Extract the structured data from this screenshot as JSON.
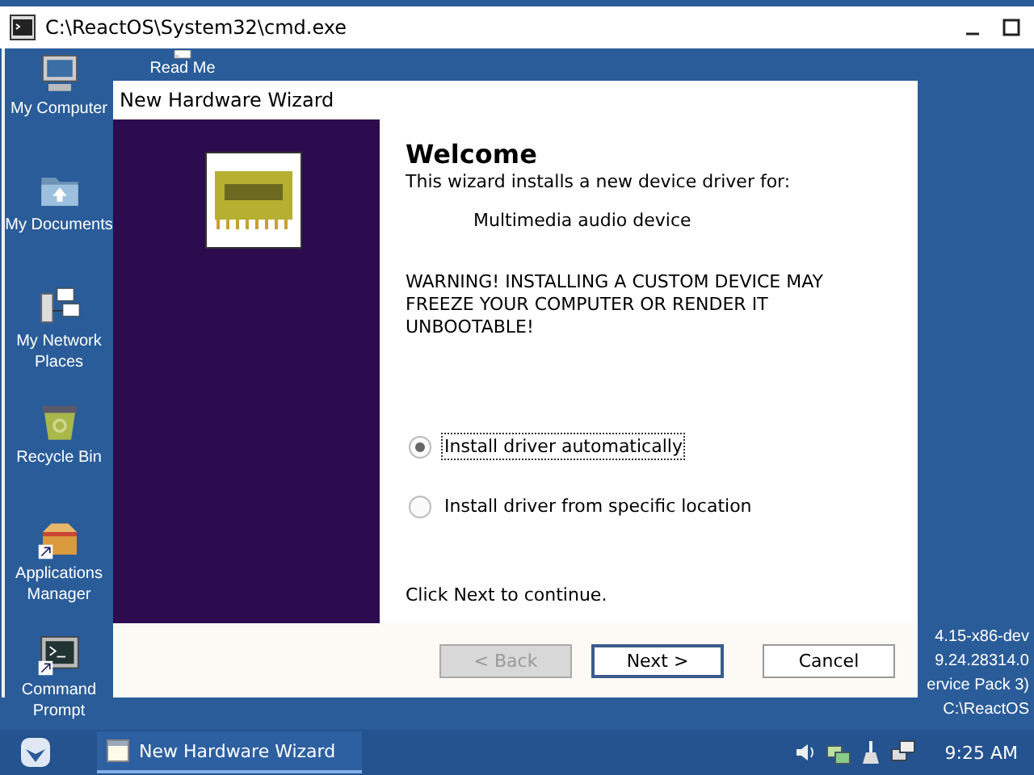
{
  "cmd_window": {
    "title": "C:\\ReactOS\\System32\\cmd.exe"
  },
  "desktop_icons": [
    {
      "label": "My Computer",
      "kind": "computer"
    },
    {
      "label": "My Documents",
      "kind": "folder"
    },
    {
      "label": "My Network Places",
      "kind": "network"
    },
    {
      "label": "Recycle Bin",
      "kind": "recycle"
    },
    {
      "label": "Applications Manager",
      "kind": "package",
      "shortcut": true
    },
    {
      "label": "Command Prompt",
      "kind": "terminal",
      "shortcut": true
    }
  ],
  "desktop_icons_column_2": [
    {
      "label": "Read Me",
      "kind": "document"
    }
  ],
  "version_lines": [
    "4.15-x86-dev",
    "9.24.28314.0",
    "ervice Pack 3)",
    "C:\\ReactOS"
  ],
  "wizard": {
    "title": "New Hardware Wizard",
    "heading": "Welcome",
    "intro": "This wizard installs a new device driver for:",
    "device": "Multimedia audio device",
    "warning": "WARNING! INSTALLING A CUSTOM DEVICE MAY FREEZE YOUR COMPUTER OR RENDER IT UNBOOTABLE!",
    "options": [
      {
        "label": "Install driver automatically",
        "selected": true
      },
      {
        "label": "Install driver from specific location",
        "selected": false
      }
    ],
    "footer": "Click Next to continue.",
    "buttons": [
      {
        "label": "< Back",
        "disabled": true,
        "default": false
      },
      {
        "label": "Next >",
        "disabled": false,
        "default": true
      },
      {
        "label": "Cancel",
        "disabled": false,
        "default": false
      }
    ]
  },
  "taskbar": {
    "tasks": [
      {
        "label": "New Hardware Wizard",
        "selected": true
      }
    ],
    "clock": "9:25 AM"
  }
}
